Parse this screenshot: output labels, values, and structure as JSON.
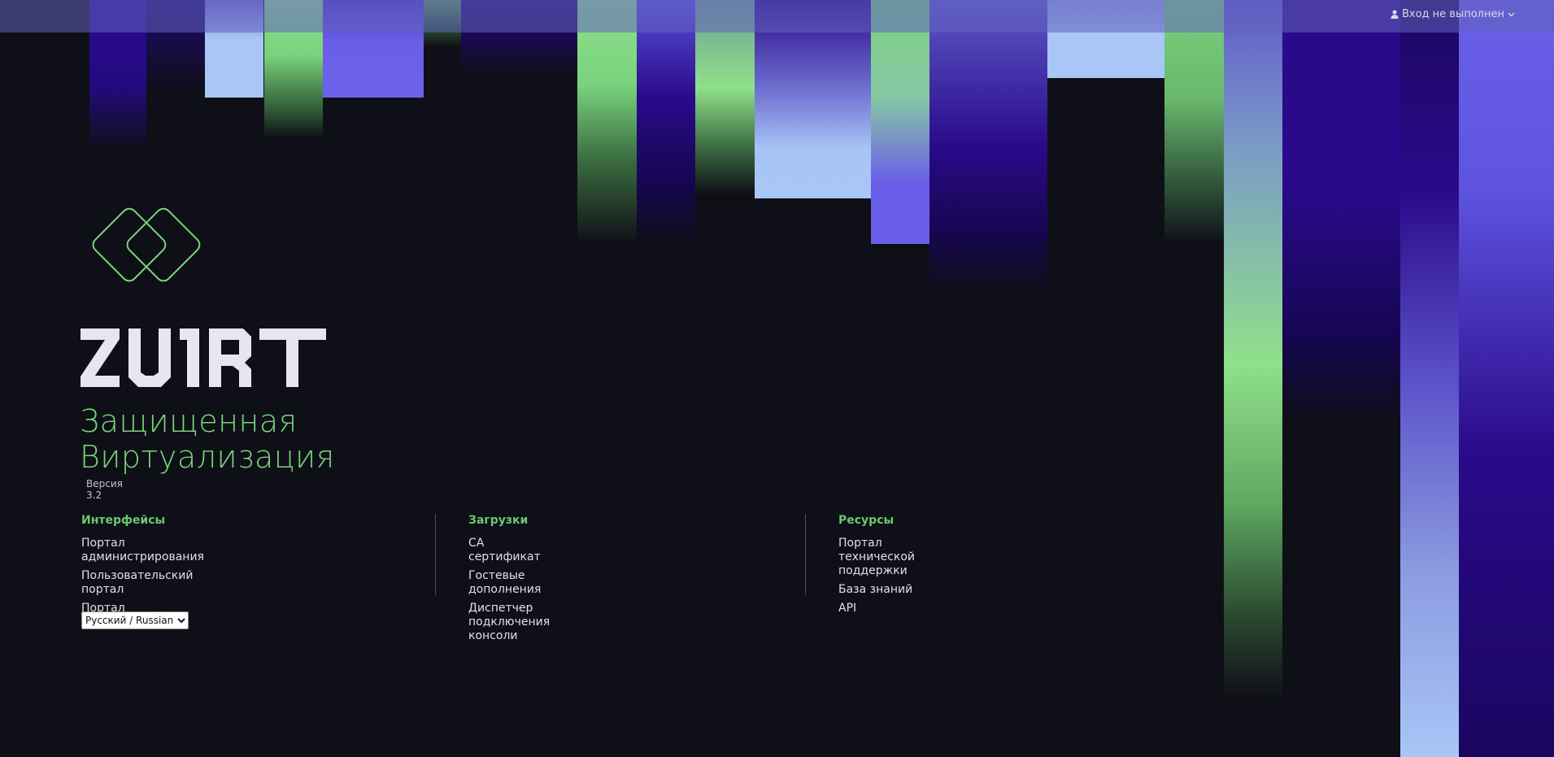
{
  "header": {
    "login_status": "Вход не выполнен",
    "user_icon": "user-icon",
    "dropdown_icon": "chevron-down-icon"
  },
  "brand": {
    "logo_icon": "double-diamond-logo",
    "name": "ZVIRT",
    "tagline_line1": "Защищенная",
    "tagline_line2": "Виртуализация",
    "version": "Версия 3.2"
  },
  "columns": [
    {
      "heading": "Интерфейсы",
      "links": [
        "Портал администрирования",
        "Пользовательский портал",
        "Портал мониторинга"
      ]
    },
    {
      "heading": "Загрузки",
      "links": [
        "CA сертификат",
        "Гостевые дополнения",
        "Диспетчер подключения консоли"
      ]
    },
    {
      "heading": "Ресурсы",
      "links": [
        "Портал технической поддержки",
        "База знаний",
        "API"
      ]
    }
  ],
  "language": {
    "selected": "Русский / Russian",
    "options": [
      "Русский / Russian"
    ]
  },
  "colors": {
    "background": "#0f0f17",
    "accent_green": "#79d57a",
    "heading_green": "#6cc86f",
    "violet": "#6a5fe8",
    "deep_indigo": "#2a0a8a",
    "light_blue": "#a6c4f5",
    "header_bar": "#6262be"
  }
}
